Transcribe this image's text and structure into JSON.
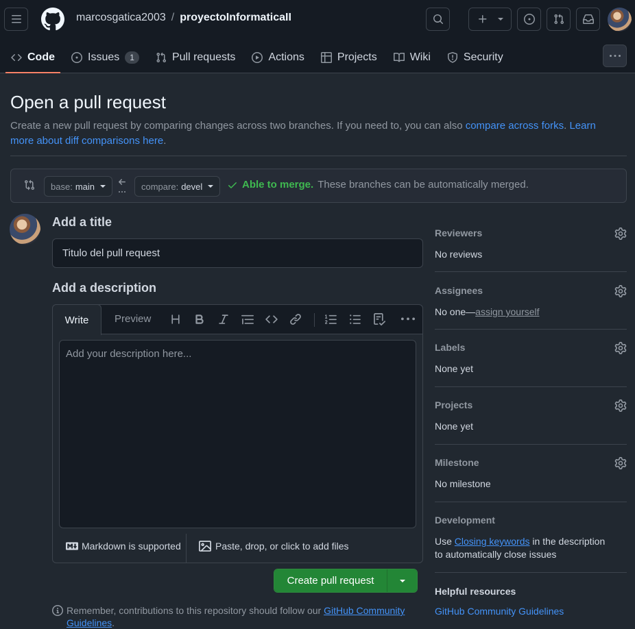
{
  "header": {
    "owner": "marcosgatica2003",
    "separator": "/",
    "repo": "proyectoInformaticaII"
  },
  "nav": {
    "tabs": [
      {
        "label": "Code"
      },
      {
        "label": "Issues",
        "count": "1"
      },
      {
        "label": "Pull requests"
      },
      {
        "label": "Actions"
      },
      {
        "label": "Projects"
      },
      {
        "label": "Wiki"
      },
      {
        "label": "Security"
      }
    ]
  },
  "page": {
    "title": "Open a pull request",
    "subtitle_text": "Create a new pull request by comparing changes across two branches. If you need to, you can also ",
    "compare_forks_link": "compare across forks",
    "subtitle_dot": ".",
    "learn_more_link": "Learn more about diff comparisons here",
    "subtitle_end": "."
  },
  "range": {
    "base_key": "base:",
    "base_value": "main",
    "compare_key": "compare:",
    "compare_value": "devel",
    "merge_status": "Able to merge.",
    "merge_detail": "These branches can be automatically merged."
  },
  "form": {
    "add_title_label": "Add a title",
    "title_value": "Titulo del pull request",
    "add_description_label": "Add a description",
    "write_tab": "Write",
    "preview_tab": "Preview",
    "description_placeholder": "Add your description here...",
    "markdown_note": "Markdown is supported",
    "attach_note": "Paste, drop, or click to add files",
    "create_button": "Create pull request",
    "guideline_note": "Remember, contributions to this repository should follow our ",
    "guideline_link": "GitHub Community Guidelines",
    "guideline_end": "."
  },
  "sidebar": {
    "reviewers": {
      "title": "Reviewers",
      "value": "No reviews"
    },
    "assignees": {
      "title": "Assignees",
      "value": "No one—",
      "link": "assign yourself"
    },
    "labels": {
      "title": "Labels",
      "value": "None yet"
    },
    "projects": {
      "title": "Projects",
      "value": "None yet"
    },
    "milestone": {
      "title": "Milestone",
      "value": "No milestone"
    },
    "development": {
      "title": "Development",
      "prefix": "Use ",
      "link": "Closing keywords",
      "suffix": " in the description to automatically close issues"
    },
    "helpful": {
      "title": "Helpful resources",
      "link": "GitHub Community Guidelines"
    }
  }
}
